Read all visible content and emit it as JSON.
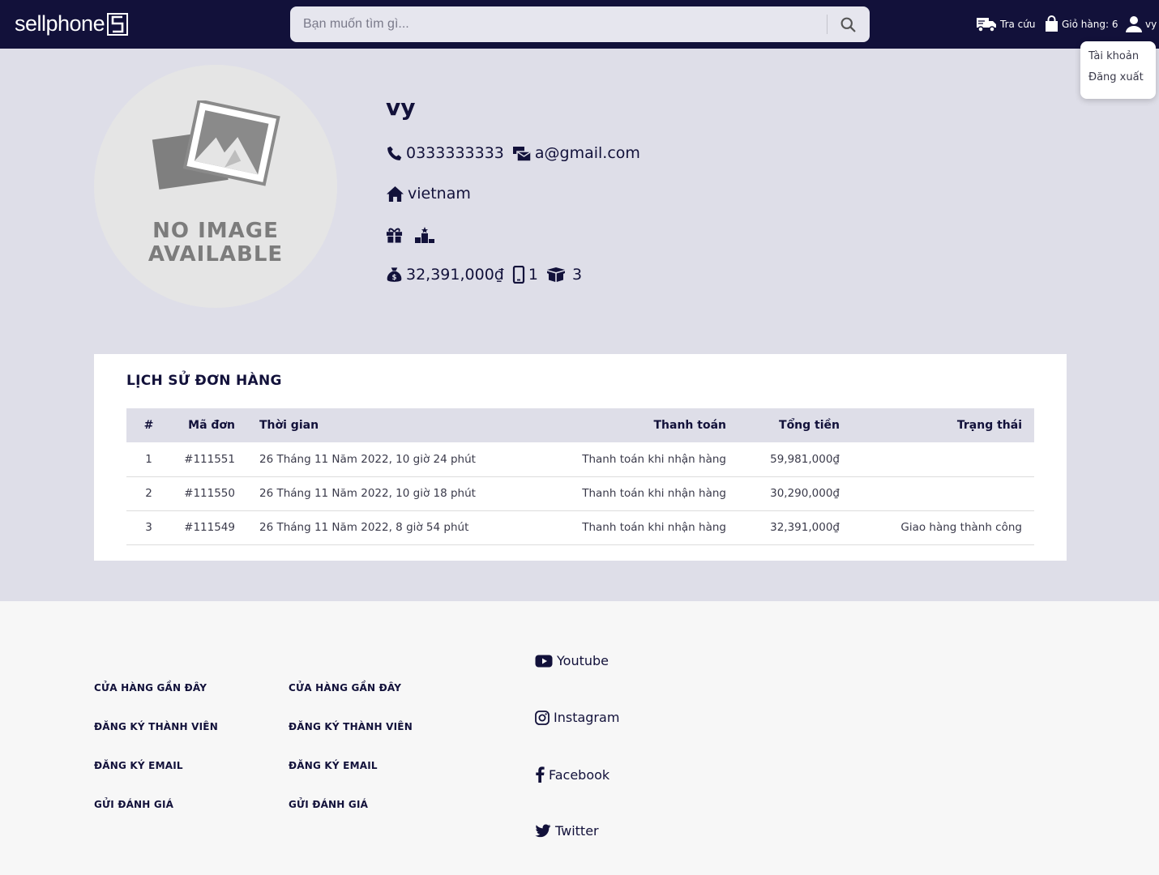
{
  "header": {
    "logo_text": "sellphone",
    "logo_box_letter": "S",
    "search_placeholder": "Bạn muốn tìm gì...",
    "track_label": "Tra cứu",
    "cart_label": "Giỏ hàng: 6",
    "user_label": "vy"
  },
  "user_menu": {
    "items": [
      "Tài khoản",
      "Đăng xuất"
    ]
  },
  "profile": {
    "avatar_text_line1": "NO IMAGE",
    "avatar_text_line2": "AVAILABLE",
    "name": "vy",
    "phone": "0333333333",
    "email": "a@gmail.com",
    "address": "vietnam",
    "total_spent": "32,391,000₫",
    "products_count": "1",
    "orders_count": "3"
  },
  "orders": {
    "title": "LỊCH SỬ ĐƠN HÀNG",
    "columns": [
      "#",
      "Mã đơn",
      "Thời gian",
      "Thanh toán",
      "Tổng tiền",
      "Trạng thái"
    ],
    "rows": [
      {
        "index": "1",
        "code": "#111551",
        "time": "26 Tháng 11 Năm 2022, 10 giờ 24 phút",
        "payment": "Thanh toán khi nhận hàng",
        "total": "59,981,000₫",
        "status": ""
      },
      {
        "index": "2",
        "code": "#111550",
        "time": "26 Tháng 11 Năm 2022, 10 giờ 18 phút",
        "payment": "Thanh toán khi nhận hàng",
        "total": "30,290,000₫",
        "status": ""
      },
      {
        "index": "3",
        "code": "#111549",
        "time": "26 Tháng 11 Năm 2022, 8 giờ 54 phút",
        "payment": "Thanh toán khi nhận hàng",
        "total": "32,391,000₫",
        "status": "Giao hàng thành công"
      }
    ]
  },
  "footer": {
    "col1": [
      "CỬA HÀNG GẦN ĐÂY",
      "ĐĂNG KÝ THÀNH VIÊN",
      "ĐĂNG KÝ EMAIL",
      "GỬI ĐÁNH GIÁ"
    ],
    "col2": [
      "CỬA HÀNG GẦN ĐÂY",
      "ĐĂNG KÝ THÀNH VIÊN",
      "ĐĂNG KÝ EMAIL",
      "GỬI ĐÁNH GIÁ"
    ],
    "social": [
      {
        "label": "Youtube",
        "icon": "youtube-icon"
      },
      {
        "label": "Instagram",
        "icon": "instagram-icon"
      },
      {
        "label": "Facebook",
        "icon": "facebook-icon"
      },
      {
        "label": "Twitter",
        "icon": "twitter-icon"
      }
    ]
  },
  "colors": {
    "header_bg": "#12113a",
    "profile_bg": "#dedee8",
    "footer_bg": "#f7f7f7"
  }
}
